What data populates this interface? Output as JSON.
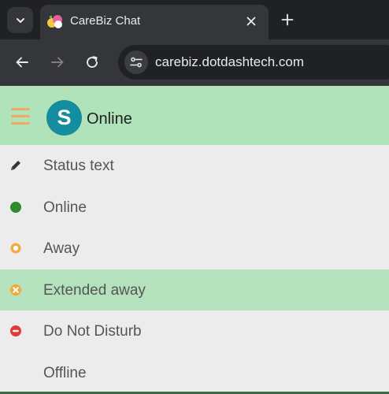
{
  "browser": {
    "tab": {
      "title": "CareBiz Chat"
    },
    "address": {
      "url": "carebiz.dotdashtech.com"
    }
  },
  "app": {
    "header": {
      "avatar_letter": "S",
      "status": "Online"
    },
    "status_menu": [
      {
        "label": "Status text",
        "icon": "pencil-icon"
      },
      {
        "label": "Online",
        "icon": "online-dot-icon",
        "color": "#2e8b2e"
      },
      {
        "label": "Away",
        "icon": "away-ring-icon",
        "color": "#f2a93b"
      },
      {
        "label": "Extended away",
        "icon": "extended-away-icon",
        "color": "#f2a93b",
        "selected": true
      },
      {
        "label": "Do Not Disturb",
        "icon": "dnd-icon",
        "color": "#e53935"
      },
      {
        "label": "Offline",
        "icon": "",
        "color": ""
      }
    ]
  },
  "colors": {
    "header_bg": "#b0e3b9",
    "selected_row_bg": "#b4e2bd",
    "avatar_bg": "#148d9f",
    "hamburger": "#f4a663"
  }
}
